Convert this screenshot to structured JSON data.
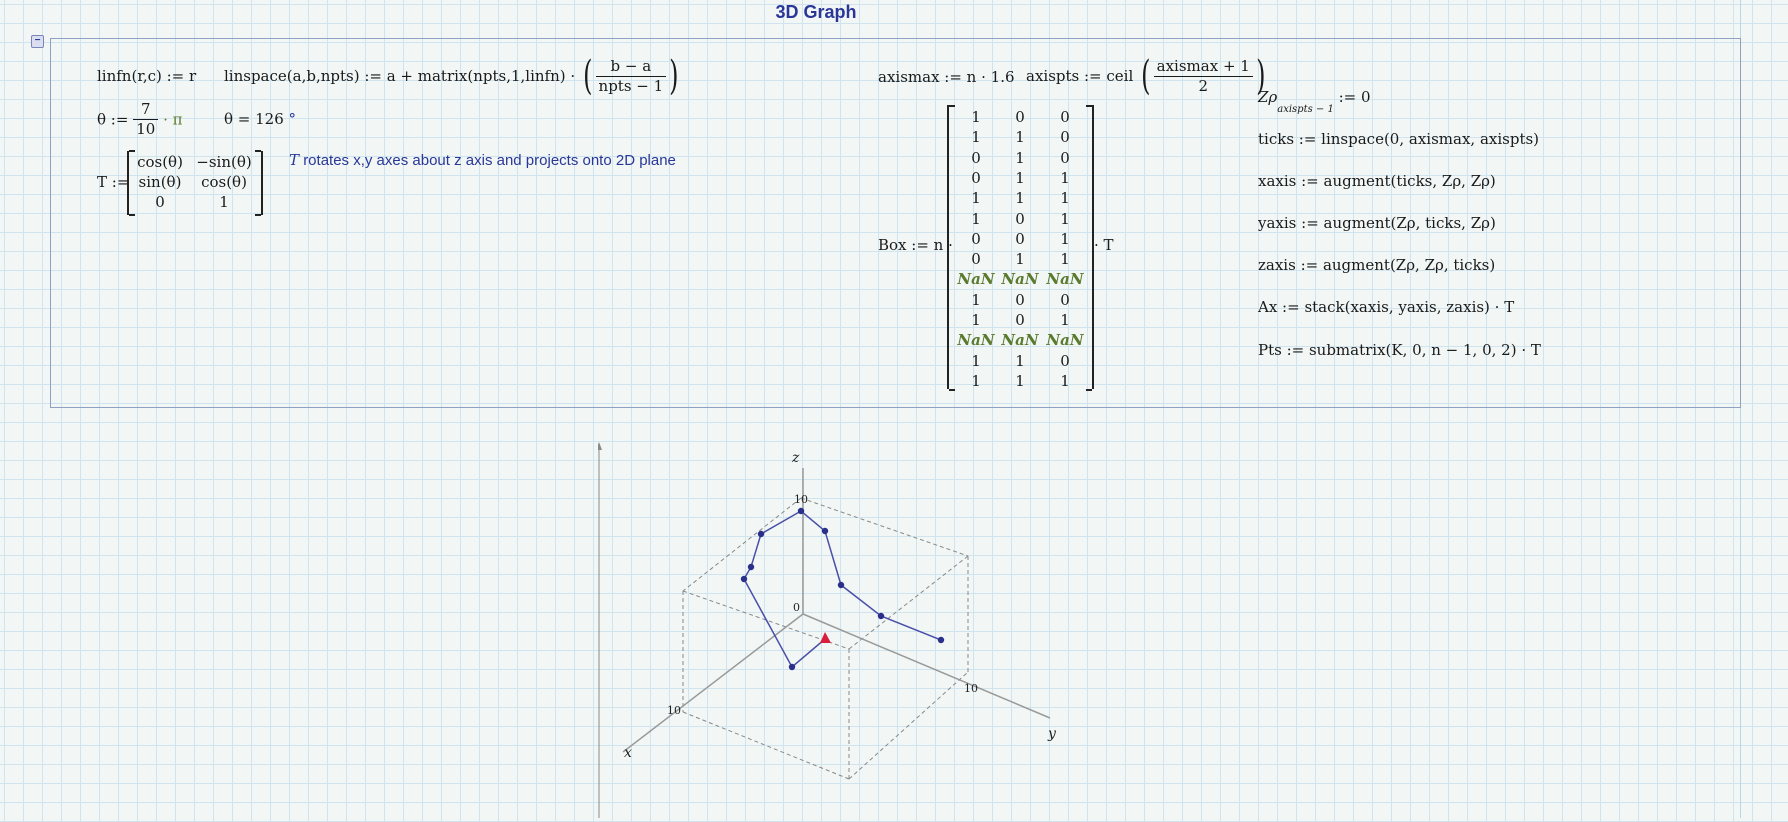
{
  "page": {
    "title": "3D Graph"
  },
  "region": {
    "collapse_glyph": "−"
  },
  "defs": {
    "linfn": "linfn(r,c) := r",
    "linspace": "linspace(a,b,npts) := a + matrix(npts,1,linfn) ·",
    "linspace_num": "b − a",
    "linspace_den": "npts − 1",
    "theta_lhs": "θ :=",
    "theta_num": "7",
    "theta_den": "10",
    "theta_pi": "· π",
    "theta_eval": "θ = 126",
    "theta_unit": "°",
    "T_lhs": "T :=",
    "T_matrix": [
      [
        "cos(θ)",
        "−sin(θ)"
      ],
      [
        "sin(θ)",
        "cos(θ)"
      ],
      [
        "0",
        "1"
      ]
    ],
    "note_var": "T",
    "note_text": "rotates x,y axes about z axis and projects onto 2D plane",
    "axismax": "axismax := n · 1.6",
    "axispts_lhs": "axispts := ceil",
    "axispts_num": "axismax + 1",
    "axispts_den": "2",
    "box_lhs": "Box := n ·",
    "box_rhs": "· T",
    "box_matrix": [
      [
        "1",
        "0",
        "0"
      ],
      [
        "1",
        "1",
        "0"
      ],
      [
        "0",
        "1",
        "0"
      ],
      [
        "0",
        "1",
        "1"
      ],
      [
        "1",
        "1",
        "1"
      ],
      [
        "1",
        "0",
        "1"
      ],
      [
        "0",
        "0",
        "1"
      ],
      [
        "0",
        "1",
        "1"
      ],
      [
        "NaN",
        "NaN",
        "NaN"
      ],
      [
        "1",
        "0",
        "0"
      ],
      [
        "1",
        "0",
        "1"
      ],
      [
        "NaN",
        "NaN",
        "NaN"
      ],
      [
        "1",
        "1",
        "0"
      ],
      [
        "1",
        "1",
        "1"
      ]
    ],
    "zp": "Zρ",
    "zp_sub": "axispts − 1",
    "zp_rhs": ":= 0",
    "ticks": "ticks := linspace(0, axismax, axispts)",
    "xaxis": "xaxis := augment(ticks, Zρ, Zρ)",
    "yaxis": "yaxis := augment(Zρ, ticks, Zρ)",
    "zaxis": "zaxis := augment(Zρ, Zρ, ticks)",
    "ax": "Ax := stack(xaxis, yaxis, zaxis) · T",
    "pts": "Pts := submatrix(K, 0, n − 1, 0, 2) · T"
  },
  "plot": {
    "axis_labels": {
      "x": "x",
      "y": "y",
      "z": "z"
    },
    "tick_labels": {
      "z_top": "10",
      "origin": "0",
      "x_end": "10",
      "y_end": "10"
    },
    "series_color": "#3a3f9a",
    "marker_color": "#d81e3c",
    "grid_color": "#888888"
  }
}
